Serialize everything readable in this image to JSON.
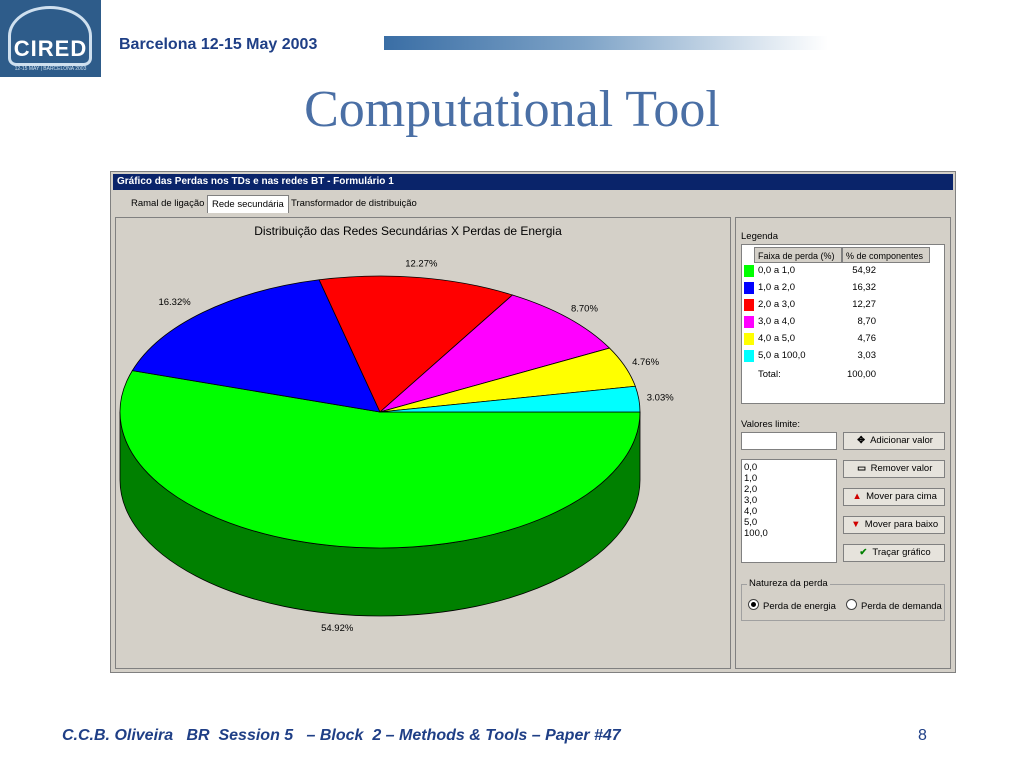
{
  "slide": {
    "logo_text": "CIRED",
    "logo_subtext": "12-15 MAY | BARCELONA 2003",
    "conference": "Barcelona  12-15 May 2003",
    "title": "Computational Tool",
    "footer": "C.C.B. Oliveira   BR  Session 5   – Block  2 – Methods & Tools – Paper #47",
    "page_number": "8"
  },
  "window": {
    "title": "Gráfico das Perdas nos TDs e nas redes BT - Formulário 1",
    "tabs": [
      {
        "label": "Ramal de ligação",
        "active": false
      },
      {
        "label": "Rede secundária",
        "active": true
      },
      {
        "label": "Transformador de distribuição",
        "active": false
      }
    ]
  },
  "chart_data": {
    "type": "pie",
    "title": "Distribuição das Redes Secundárias X Perdas de Energia",
    "style": "3d",
    "slices": [
      {
        "label": "0,0 a 1,0",
        "value": 54.92,
        "data_label": "54.92%",
        "color": "#00ff00",
        "side_color": "#008000"
      },
      {
        "label": "1,0 a 2,0",
        "value": 16.32,
        "data_label": "16.32%",
        "color": "#0000ff",
        "side_color": "#00008b"
      },
      {
        "label": "2,0 a 3,0",
        "value": 12.27,
        "data_label": "12.27%",
        "color": "#ff0000",
        "side_color": "#8b0000"
      },
      {
        "label": "3,0 a 4,0",
        "value": 8.7,
        "data_label": "8.70%",
        "color": "#ff00ff",
        "side_color": "#8b008b"
      },
      {
        "label": "4,0 a 5,0",
        "value": 4.76,
        "data_label": "4.76%",
        "color": "#ffff00",
        "side_color": "#8b8b00"
      },
      {
        "label": "5,0 a 100,0",
        "value": 3.03,
        "data_label": "3.03%",
        "color": "#00ffff",
        "side_color": "#008b8b"
      }
    ]
  },
  "legend": {
    "title": "Legenda",
    "col_range": "Faixa de perda (%)",
    "col_pct": "% de componentes",
    "rows": [
      {
        "range": "0,0 a 1,0",
        "pct": "54,92",
        "color": "#00ff00"
      },
      {
        "range": "1,0 a 2,0",
        "pct": "16,32",
        "color": "#0000ff"
      },
      {
        "range": "2,0 a 3,0",
        "pct": "12,27",
        "color": "#ff0000"
      },
      {
        "range": "3,0 a 4,0",
        "pct": "8,70",
        "color": "#ff00ff"
      },
      {
        "range": "4,0 a 5,0",
        "pct": "4,76",
        "color": "#ffff00"
      },
      {
        "range": "5,0 a 100,0",
        "pct": "3,03",
        "color": "#00ffff"
      }
    ],
    "total_label": "Total:",
    "total_value": "100,00"
  },
  "controls": {
    "limits_label": "Valores limite:",
    "limit_input_value": "",
    "limit_values": [
      "0,0",
      "1,0",
      "2,0",
      "3,0",
      "4,0",
      "5,0",
      "100,0"
    ],
    "buttons": {
      "add": "Adicionar valor",
      "remove": "Remover valor",
      "up": "Mover para cima",
      "down": "Mover para baixo",
      "plot": "Traçar gráfico"
    },
    "natureza_label": "Natureza da perda",
    "radio_energy": "Perda de energia",
    "radio_demand": "Perda de demanda",
    "selected": "energy"
  }
}
